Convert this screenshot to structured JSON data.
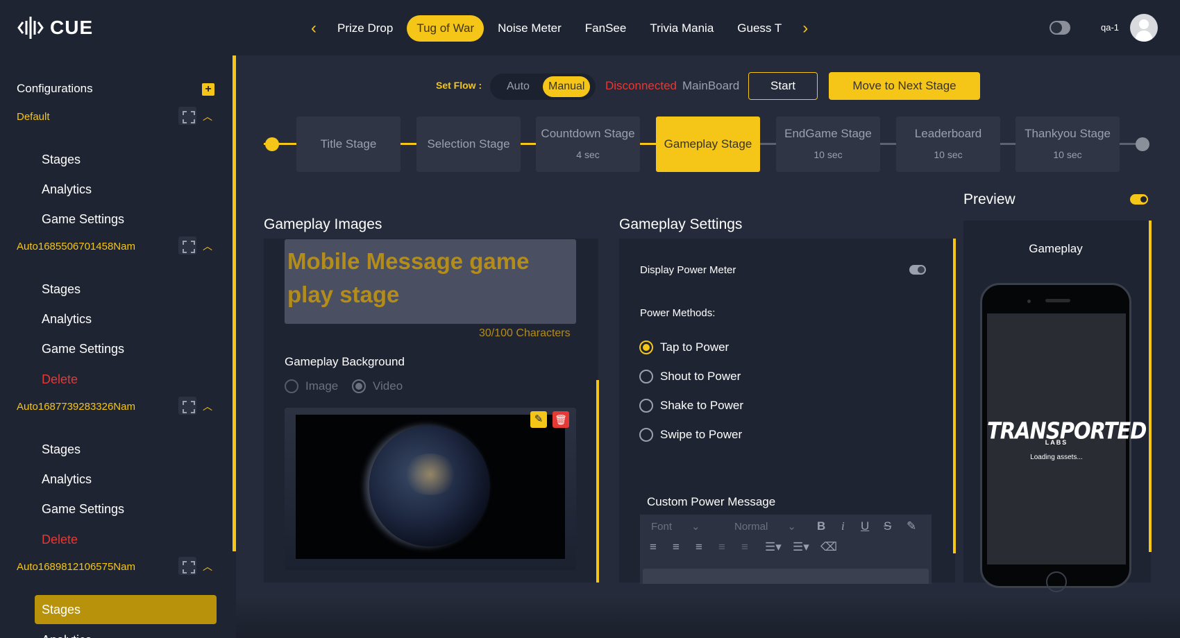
{
  "app": {
    "name": "CUE"
  },
  "header": {
    "games": [
      "Prize Drop",
      "Tug of War",
      "Noise Meter",
      "FanSee",
      "Trivia Mania",
      "Guess T"
    ],
    "active_game": "Tug of War",
    "user": "qa-1"
  },
  "sidebar": {
    "title": "Configurations",
    "groups": [
      {
        "name": "Default",
        "items": [
          "Stages",
          "Analytics",
          "Game Settings"
        ]
      },
      {
        "name": "Auto1685506701458Nam",
        "items": [
          "Stages",
          "Analytics",
          "Game Settings",
          "Delete"
        ]
      },
      {
        "name": "Auto1687739283326Nam",
        "items": [
          "Stages",
          "Analytics",
          "Game Settings",
          "Delete"
        ]
      },
      {
        "name": "Auto1689812106575Nam",
        "items": [
          "Stages",
          "Analytics"
        ]
      }
    ],
    "active_item": "Stages"
  },
  "flow": {
    "label": "Set Flow :",
    "options": [
      "Auto",
      "Manual"
    ],
    "selected": "Manual",
    "status": "Disconnected",
    "board": "MainBoard",
    "start_label": "Start",
    "next_label": "Move to Next Stage"
  },
  "stages": [
    {
      "name": "Title Stage",
      "duration": ""
    },
    {
      "name": "Selection Stage",
      "duration": ""
    },
    {
      "name": "Countdown Stage",
      "duration": "4 sec"
    },
    {
      "name": "Gameplay Stage",
      "duration": ""
    },
    {
      "name": "EndGame Stage",
      "duration": "10 sec"
    },
    {
      "name": "Leaderboard",
      "duration": "10 sec"
    },
    {
      "name": "Thankyou Stage",
      "duration": "10 sec"
    }
  ],
  "active_stage": "Gameplay Stage",
  "images": {
    "title": "Gameplay Images",
    "message": "Mobile Message game play stage",
    "char_count": "30/100 Characters",
    "bg_label": "Gameplay Background",
    "bg_options": [
      "Image",
      "Video"
    ],
    "bg_selected": "Video"
  },
  "settings": {
    "title": "Gameplay Settings",
    "display_power_meter": "Display Power Meter",
    "power_methods_label": "Power Methods:",
    "methods": [
      "Tap to Power",
      "Shout to Power",
      "Shake to Power",
      "Swipe to Power"
    ],
    "selected_method": "Tap to Power",
    "custom_message_title": "Custom Power Message",
    "editor": {
      "font": "Font",
      "size": "Normal"
    }
  },
  "preview": {
    "title": "Preview",
    "label": "Gameplay",
    "brand": "TRANSPORTED",
    "brand_sub": "LABS",
    "loading": "Loading assets..."
  },
  "colors": {
    "accent": "#f5c518",
    "danger": "#e53935",
    "bg": "#1c2130",
    "panel": "#1f2433"
  }
}
